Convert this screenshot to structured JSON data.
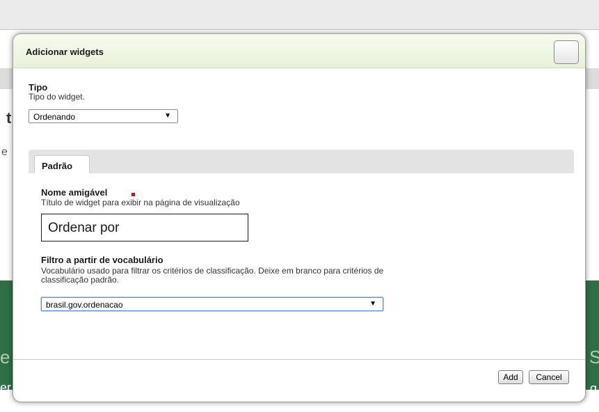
{
  "background": {
    "fragment_t": "t",
    "fragment_e": "e",
    "fragment_e2": "e",
    "fragment_er": "er",
    "fragment_s": "S",
    "fragment_q": "q"
  },
  "modal": {
    "title": "Adicionar widgets",
    "tipo": {
      "label": "Tipo",
      "help": "Tipo do widget.",
      "value": "Ordenando"
    },
    "tab": {
      "label": "Padrão"
    },
    "nome": {
      "label": "Nome amigável",
      "help": "Título de widget para exibir na página de visualização",
      "value": "Ordenar por"
    },
    "filtro": {
      "label": "Filtro a partir de vocabulário",
      "help_line1": "Vocabulário usado para filtrar os critérios de classificação. Deixe em branco para critérios de",
      "help_line2": "classificação padrão.",
      "value": "brasil.gov.ordenacao"
    },
    "buttons": {
      "add": "Add",
      "cancel": "Cancel"
    }
  },
  "icons": {
    "dropdown_arrow": "▼"
  },
  "colors": {
    "title_bar": "#e8f2d8",
    "required": "#e0001a",
    "background_green": "#2f6f45"
  }
}
